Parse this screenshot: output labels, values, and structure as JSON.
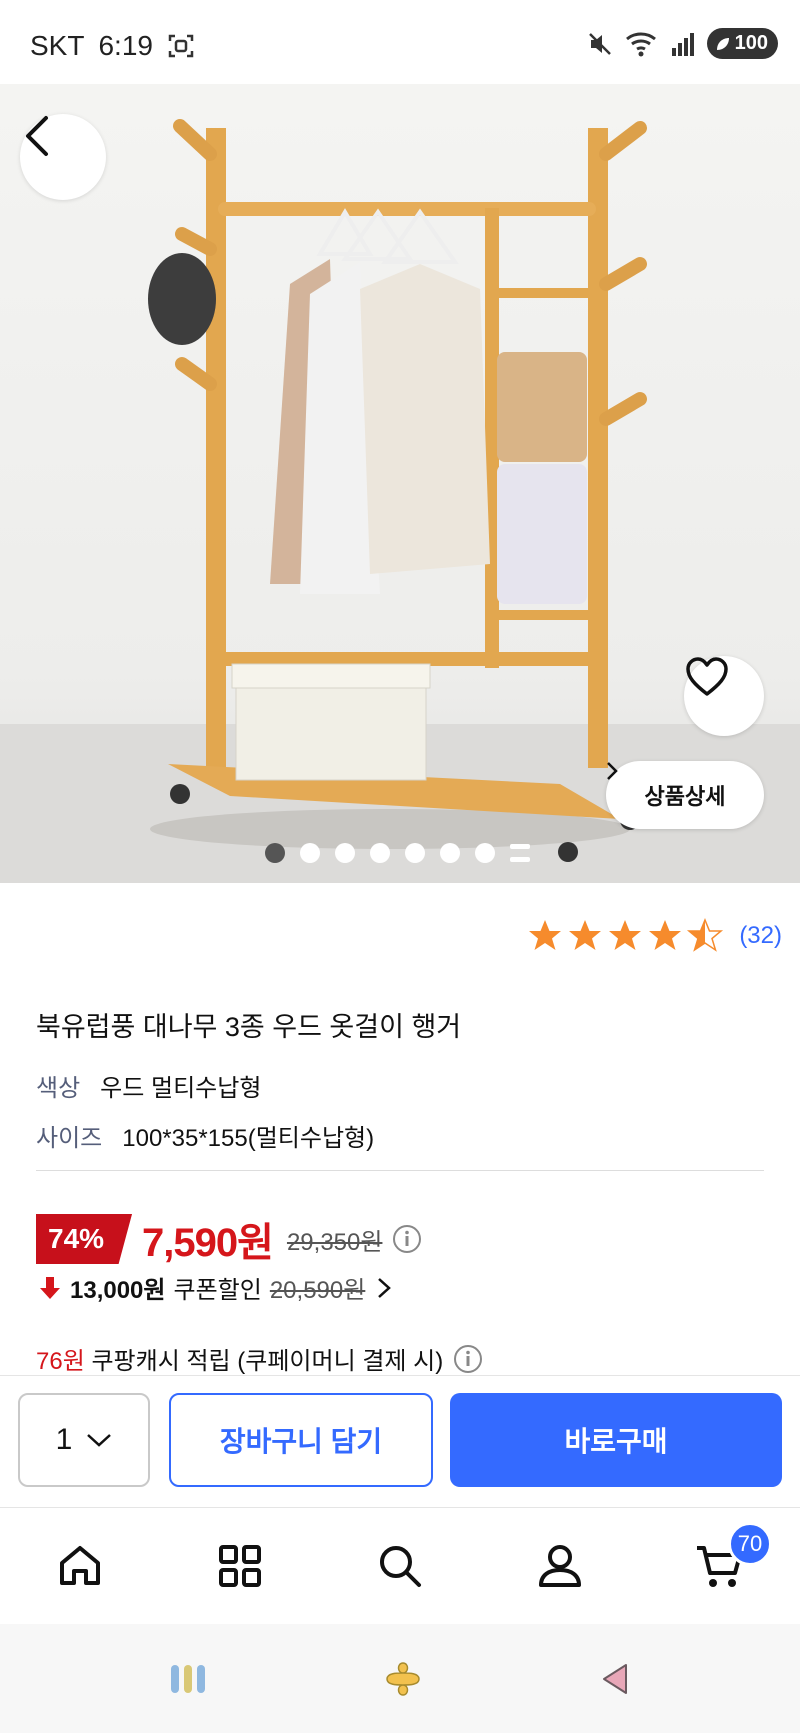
{
  "status_bar": {
    "carrier": "SKT",
    "time": "6:19",
    "battery": "100"
  },
  "gallery": {
    "detail_button_label": "상품상세",
    "page_count": 7,
    "active_index": 0
  },
  "rating": {
    "stars": 4.5,
    "count": "(32)"
  },
  "product": {
    "title": "북유럽풍 대나무 3종 우드 옷걸이 행거",
    "options": [
      {
        "label": "색상",
        "value": "우드 멀티수납형"
      },
      {
        "label": "사이즈",
        "value": "100*35*155(멀티수납형)"
      }
    ]
  },
  "price": {
    "discount_rate": "74%",
    "sale_price": "7,590원",
    "original_price": "29,350원",
    "coupon_amount": "13,000원",
    "coupon_label": "쿠폰할인",
    "coupon_original": "20,590원",
    "cash_amount": "76원",
    "cash_label": "쿠팡캐시 적립 (쿠페이머니 결제 시)"
  },
  "buy_bar": {
    "quantity": "1",
    "cart_label": "장바구니 담기",
    "buy_label": "바로구매"
  },
  "bottom_nav": {
    "cart_badge": "70"
  },
  "colors": {
    "accent": "#346aff",
    "sale": "#d5161b",
    "discount_badge": "#c7101b",
    "star": "#f68b2c"
  }
}
